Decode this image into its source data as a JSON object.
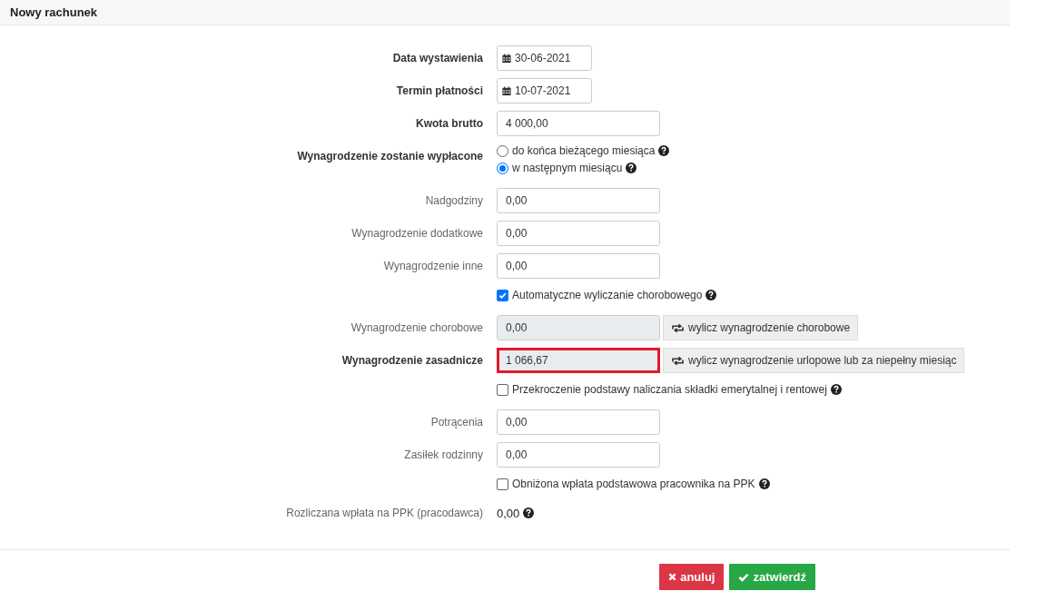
{
  "title": "Nowy rachunek",
  "fields": [
    {
      "kind": "date",
      "label": "Data wystawienia",
      "emphasized": true,
      "value": "30-06-2021"
    },
    {
      "kind": "date",
      "label": "Termin płatności",
      "emphasized": true,
      "value": "10-07-2021"
    },
    {
      "kind": "input",
      "label": "Kwota brutto",
      "emphasized": true,
      "value": "4 000,00"
    },
    {
      "kind": "radio",
      "label": "Wynagrodzenie zostanie wypłacone",
      "emphasized": true,
      "options": [
        {
          "label": "do końca bieżącego miesiąca",
          "selected": false,
          "help": true
        },
        {
          "label": "w następnym miesiącu",
          "selected": true,
          "help": true
        }
      ]
    },
    {
      "kind": "input",
      "label": "Nadgodziny",
      "emphasized": false,
      "value": "0,00"
    },
    {
      "kind": "input",
      "label": "Wynagrodzenie dodatkowe",
      "emphasized": false,
      "value": "0,00"
    },
    {
      "kind": "input",
      "label": "Wynagrodzenie inne",
      "emphasized": false,
      "value": "0,00"
    },
    {
      "kind": "checkbox",
      "text": "Automatyczne wyliczanie chorobowego",
      "checked": true,
      "help": true
    },
    {
      "kind": "compute",
      "label": "Wynagrodzenie chorobowe",
      "emphasized": false,
      "value": "0,00",
      "disabled": true,
      "highlighted": false,
      "button": "wylicz wynagrodzenie chorobowe"
    },
    {
      "kind": "compute",
      "label": "Wynagrodzenie zasadnicze",
      "emphasized": true,
      "value": "1 066,67",
      "disabled": true,
      "highlighted": true,
      "button": "wylicz wynagrodzenie urlopowe lub za niepełny miesiąc"
    },
    {
      "kind": "checkbox",
      "text": "Przekroczenie podstawy naliczania składki emerytalnej i rentowej",
      "checked": false,
      "help": true
    },
    {
      "kind": "input",
      "label": "Potrącenia",
      "emphasized": false,
      "value": "0,00"
    },
    {
      "kind": "input",
      "label": "Zasiłek rodzinny",
      "emphasized": false,
      "value": "0,00"
    },
    {
      "kind": "checkbox",
      "text": "Obniżona wpłata podstawowa pracownika na PPK",
      "checked": false,
      "help": true
    },
    {
      "kind": "value",
      "label": "Rozliczana wpłata na PPK (pracodawca)",
      "emphasized": false,
      "value": "0,00",
      "help": true
    }
  ],
  "buttons": [
    {
      "kind": "cancel",
      "label": "anuluj"
    },
    {
      "kind": "confirm",
      "label": "zatwierdź"
    }
  ]
}
